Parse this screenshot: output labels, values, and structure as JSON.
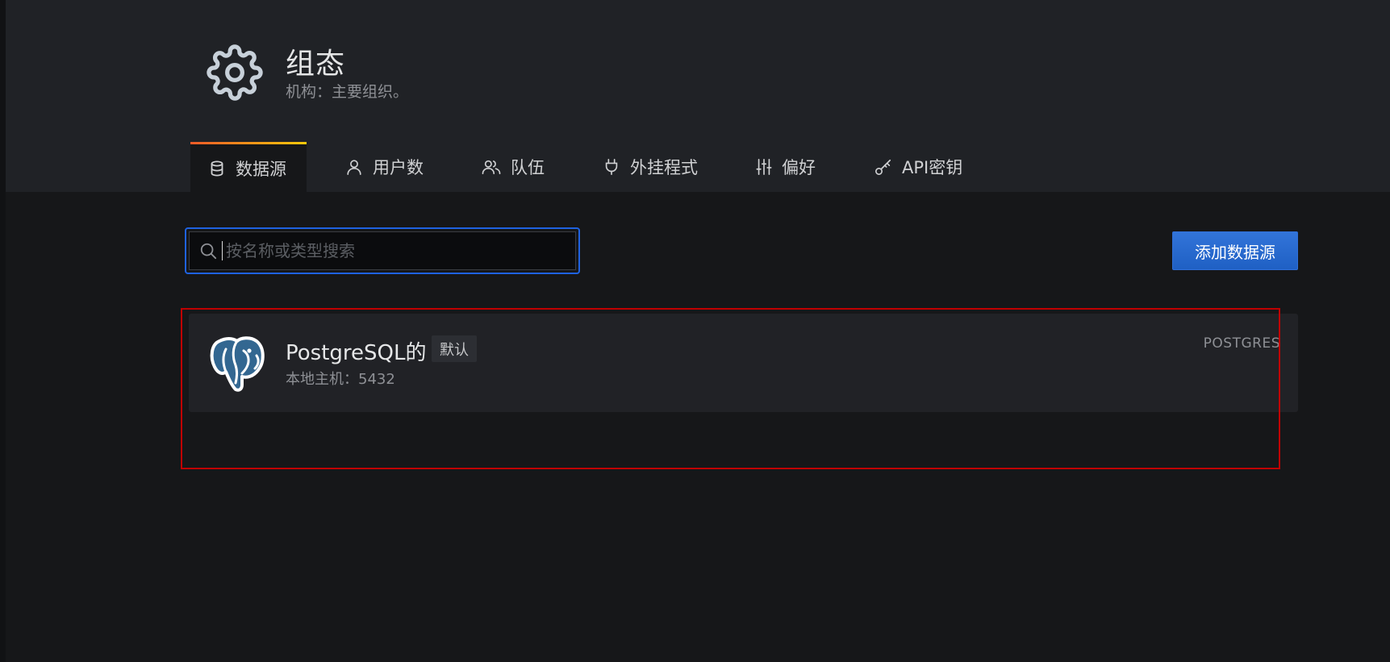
{
  "page": {
    "title": "组态",
    "subtitle": "机构：主要组织。",
    "icon": "gear-icon"
  },
  "tabs": [
    {
      "label": "数据源",
      "icon": "database-icon",
      "active": true
    },
    {
      "label": "用户数",
      "icon": "user-icon",
      "active": false
    },
    {
      "label": "队伍",
      "icon": "users-icon",
      "active": false
    },
    {
      "label": "外挂程式",
      "icon": "plug-icon",
      "active": false
    },
    {
      "label": "偏好",
      "icon": "sliders-icon",
      "active": false
    },
    {
      "label": "API密钥",
      "icon": "key-icon",
      "active": false
    }
  ],
  "search": {
    "placeholder": "按名称或类型搜索",
    "value": ""
  },
  "add_button": {
    "label": "添加数据源"
  },
  "datasources": [
    {
      "name": "PostgreSQL的",
      "badge": "默认",
      "url": "本地主机：5432",
      "type": "POSTGRES",
      "icon": "postgresql-elephant-icon"
    }
  ],
  "colors": {
    "accent_blue": "#1f62e0",
    "tab_gradient_start": "#f05a28",
    "tab_gradient_end": "#fbca0a",
    "highlight_red": "#c00000"
  }
}
